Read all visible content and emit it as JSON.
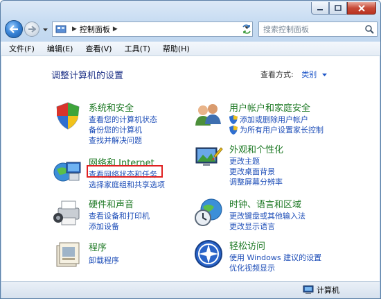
{
  "address": {
    "crumbs": [
      "控制面板"
    ]
  },
  "search": {
    "placeholder": "搜索控制面板"
  },
  "menu": [
    "文件(F)",
    "编辑(E)",
    "查看(V)",
    "工具(T)",
    "帮助(H)"
  ],
  "page": {
    "title": "调整计算机的设置",
    "view_by_label": "查看方式:",
    "view_by_value": "类别"
  },
  "categories": {
    "system": {
      "title": "系统和安全",
      "links": [
        "查看您的计算机状态",
        "备份您的计算机",
        "查找并解决问题"
      ]
    },
    "network": {
      "title": "网络和 Internet",
      "links": [
        "查看网络状态和任务",
        "选择家庭组和共享选项"
      ]
    },
    "hardware": {
      "title": "硬件和声音",
      "links": [
        "查看设备和打印机",
        "添加设备"
      ]
    },
    "programs": {
      "title": "程序",
      "links": [
        "卸载程序"
      ]
    },
    "users": {
      "title": "用户帐户和家庭安全",
      "links": [
        "添加或删除用户帐户",
        "为所有用户设置家长控制"
      ]
    },
    "appearance": {
      "title": "外观和个性化",
      "links": [
        "更改主题",
        "更改桌面背景",
        "调整屏幕分辨率"
      ]
    },
    "clock": {
      "title": "时钟、语言和区域",
      "links": [
        "更改键盘或其他输入法",
        "更改显示语言"
      ]
    },
    "ease": {
      "title": "轻松访问",
      "links": [
        "使用 Windows 建议的设置",
        "优化视频显示"
      ]
    }
  },
  "status": {
    "computer_label": "计算机"
  },
  "colors": {
    "category_title": "#1f7a26",
    "link": "#1e4eb8",
    "highlight": "#e02020",
    "page_title": "#1e3287"
  }
}
